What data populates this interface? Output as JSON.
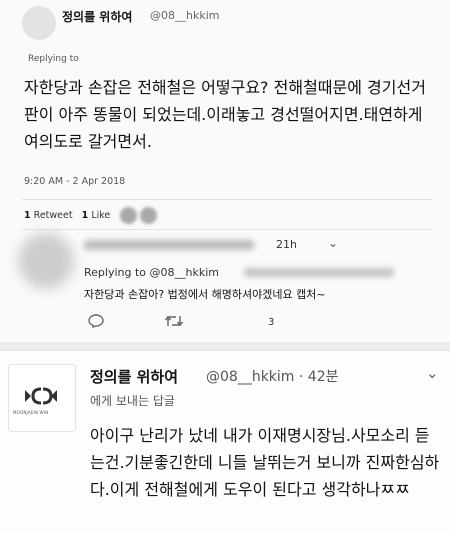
{
  "tweet": {
    "display_name": "정의를 위하여",
    "handle": "@08__hkkim",
    "replying_to": "Replying to",
    "text": "자한당과 손잡은 전해철은 어떻구요? 전해철때문에 경기선거판이 아주 똥물이 되었는데.이래놓고 경선떨어지면.태연하게 여의도로 갈거면서.",
    "timestamp": "9:20 AM - 2 Apr 2018",
    "retweets": "1",
    "retweets_label": "Retweet",
    "likes": "1",
    "likes_label": "Like"
  },
  "reply": {
    "time": "21h",
    "chevron_icon": "chevron-down-icon",
    "replying_to": "Replying to @08__hkkim",
    "text": "자한당과 손잡아? 법정에서 해명하셔야겠네요 캡처~",
    "actions": {
      "reply_icon": "reply-icon",
      "retweet_icon": "retweet-icon",
      "like_count": "3"
    }
  },
  "tweet2": {
    "display_name": "정의를 위하여",
    "handle_time": "@08__hkkim · 42분",
    "reply_line": "에게 보내는 답글",
    "text": "아이구 난리가 났네 내가 이재명시장님.사모소리 듣는건.기분좋긴한데 니들 날뛰는거 보니까 진짜한심하다.이게 전해철에게 도우이 된다고 생각하나ㅉㅉ",
    "chevron_icon": "chevron-down-icon",
    "avatar_logo": "MC-logo",
    "avatar_logo_text": "MOONJAEIN WIN"
  },
  "colors": {
    "text": "#141414",
    "muted": "#555555",
    "pane_bg": "#fafafa"
  }
}
